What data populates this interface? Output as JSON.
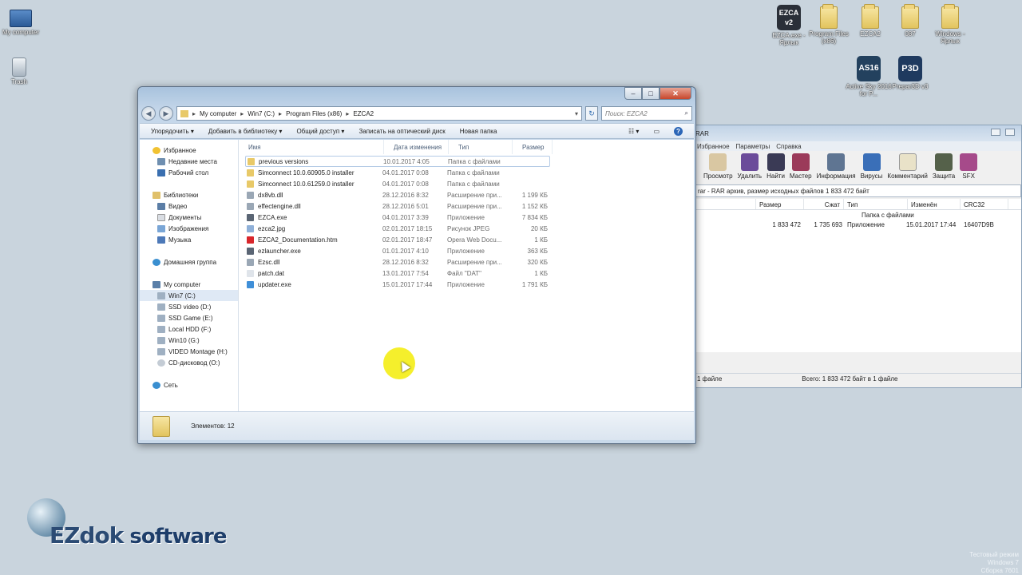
{
  "desktop": {
    "icons_left": [
      {
        "label": "My computer"
      },
      {
        "label": "Trash"
      }
    ],
    "icons_top_right": [
      {
        "label": "EZCA.exe - Ярлык",
        "glyph": "EZCA v2"
      },
      {
        "label": "Program Files (x86)"
      },
      {
        "label": "EZCA2"
      },
      {
        "label": "087"
      },
      {
        "label": "Windows - Ярлык"
      },
      {
        "label": "Active Sky 2016 for P...",
        "glyph": "AS16"
      },
      {
        "label": "Prepar3D v3",
        "glyph": "P3D"
      }
    ],
    "logo": {
      "part1": "EZdok",
      "part2": " software"
    },
    "watermark": [
      "Тестовый режим",
      "Windows 7",
      "Сборка 7601"
    ]
  },
  "explorer": {
    "breadcrumb": [
      "My computer",
      "Win7  (C:)",
      "Program Files (x86)",
      "EZCA2"
    ],
    "search_placeholder": "Поиск: EZCA2",
    "toolbar": [
      "Упорядочить ▾",
      "Добавить в библиотеку ▾",
      "Общий доступ ▾",
      "Записать на оптический диск",
      "Новая папка"
    ],
    "nav": {
      "favorites": "Избранное",
      "fav_items": [
        "Недавние места",
        "Рабочий стол"
      ],
      "libraries": "Библиотеки",
      "lib_items": [
        "Видео",
        "Документы",
        "Изображения",
        "Музыка"
      ],
      "homegroup": "Домашняя группа",
      "computer": "My computer",
      "drives": [
        "Win7  (C:)",
        "SSD video (D:)",
        "SSD Game (E:)",
        "Local HDD (F:)",
        "Win10 (G:)",
        "VIDEO Montage (H:)",
        "CD-дисковод (O:)"
      ],
      "network": "Сеть"
    },
    "columns": [
      "Имя",
      "Дата изменения",
      "Тип",
      "Размер"
    ],
    "files": [
      {
        "name": "previous versions",
        "date": "10.01.2017 4:05",
        "type": "Папка с файлами",
        "size": "",
        "icon": "folder-icon",
        "color": "#e8c968"
      },
      {
        "name": "Simconnect 10.0.60905.0 installer",
        "date": "04.01.2017 0:08",
        "type": "Папка с файлами",
        "size": "",
        "icon": "folder-icon",
        "color": "#e8c968"
      },
      {
        "name": "Simconnect 10.0.61259.0 installer",
        "date": "04.01.2017 0:08",
        "type": "Папка с файлами",
        "size": "",
        "icon": "folder-icon",
        "color": "#e8c968"
      },
      {
        "name": "dx8vb.dll",
        "date": "28.12.2016 8:32",
        "type": "Расширение при...",
        "size": "1 199 КБ",
        "icon": "dll-icon",
        "color": "#9aa7b5"
      },
      {
        "name": "effectengine.dll",
        "date": "28.12.2016 5:01",
        "type": "Расширение при...",
        "size": "1 152 КБ",
        "icon": "dll-icon",
        "color": "#9aa7b5"
      },
      {
        "name": "EZCA.exe",
        "date": "04.01.2017 3:39",
        "type": "Приложение",
        "size": "7 834 КБ",
        "icon": "exe-icon",
        "color": "#5a6574"
      },
      {
        "name": "ezca2.jpg",
        "date": "02.01.2017 18:15",
        "type": "Рисунок JPEG",
        "size": "20 КБ",
        "icon": "image-icon",
        "color": "#8fb0d8"
      },
      {
        "name": "EZCA2_Documentation.htm",
        "date": "02.01.2017 18:47",
        "type": "Opera Web Docu...",
        "size": "1 КБ",
        "icon": "opera-icon",
        "color": "#d8262b"
      },
      {
        "name": "ezlauncher.exe",
        "date": "01.01.2017 4:10",
        "type": "Приложение",
        "size": "363 КБ",
        "icon": "exe-icon",
        "color": "#5a6574"
      },
      {
        "name": "Ezsc.dll",
        "date": "28.12.2016 8:32",
        "type": "Расширение при...",
        "size": "320 КБ",
        "icon": "dll-icon",
        "color": "#9aa7b5"
      },
      {
        "name": "patch.dat",
        "date": "13.01.2017 7:54",
        "type": "Файл \"DAT\"",
        "size": "1 КБ",
        "icon": "file-icon",
        "color": "#dfe4ea"
      },
      {
        "name": "updater.exe",
        "date": "15.01.2017 17:44",
        "type": "Приложение",
        "size": "1 791 КБ",
        "icon": "globe-icon",
        "color": "#3f8fd8"
      }
    ],
    "status": "Элементов: 12"
  },
  "winrar": {
    "title": "RAR",
    "menu": [
      "Избранное",
      "Параметры",
      "Справка"
    ],
    "tools": [
      "Просмотр",
      "Удалить",
      "Найти",
      "Мастер",
      "Информация",
      "Вирусы",
      "Комментарий",
      "Защита",
      "SFX"
    ],
    "info": "rar - RAR архив, размер исходных файлов 1 833 472 байт",
    "columns": [
      "Размер",
      "Сжат",
      "Тип",
      "Изменён",
      "CRC32"
    ],
    "rows": [
      {
        "size": "",
        "packed": "",
        "type": "Папка с файлами",
        "modified": "",
        "crc": ""
      },
      {
        "size": "1 833 472",
        "packed": "1 735 693",
        "type": "Приложение",
        "modified": "15.01.2017 17:44",
        "crc": "16407D9B"
      }
    ],
    "status_left": "1 файле",
    "status_right": "Всего: 1 833 472 байт в 1 файле"
  }
}
